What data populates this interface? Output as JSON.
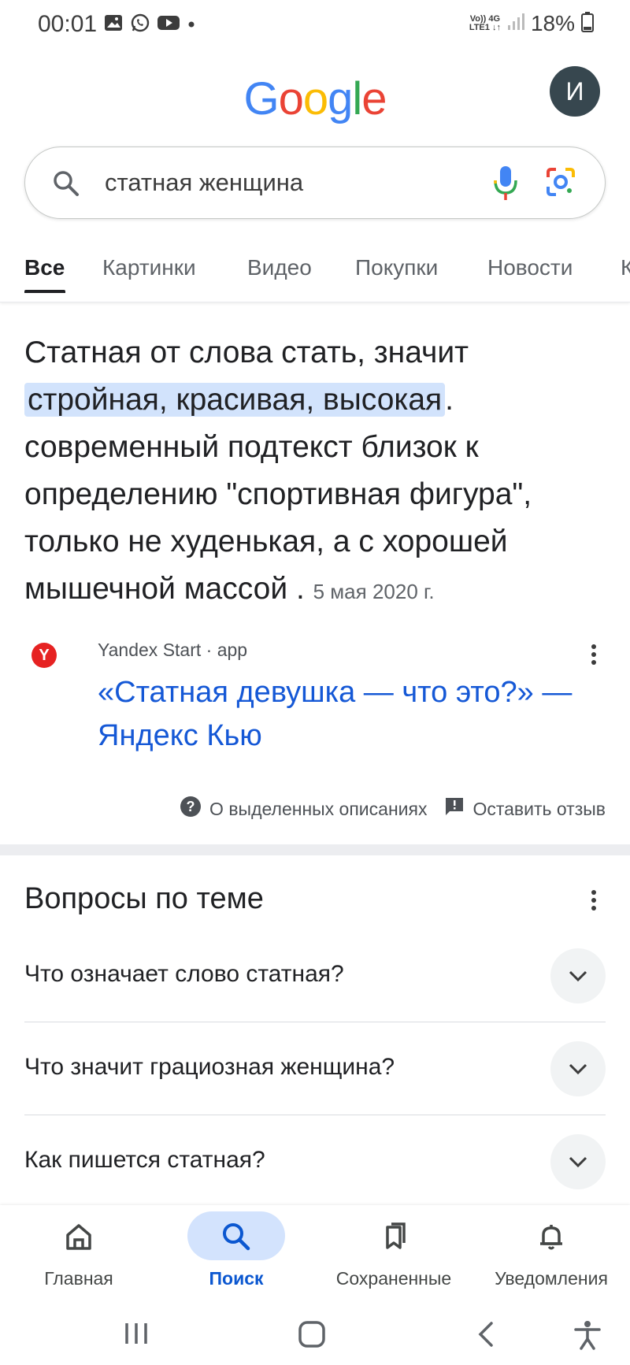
{
  "status_bar": {
    "time": "00:01",
    "net_top": "Vo)) 4G",
    "net_bottom": "LTE1 ↓↑",
    "battery": "18%"
  },
  "header": {
    "logo": "Google",
    "avatar_letter": "И"
  },
  "search": {
    "query": "статная женщина"
  },
  "tabs": [
    {
      "label": "Все",
      "active": true
    },
    {
      "label": "Картинки"
    },
    {
      "label": "Видео"
    },
    {
      "label": "Покупки"
    },
    {
      "label": "Новости"
    },
    {
      "label": "К"
    }
  ],
  "snippet": {
    "text_before": "Статная от слова стать, значит ",
    "highlight": "стройная, красивая, высокая",
    "text_after": ". современный подтекст близок к определению \"спортивная фигура\", только не худенькая, а с хорошей мышечной массой . ",
    "date": "5 мая 2020 г.",
    "source_name": "Yandex Start · app",
    "source_favicon": "Y",
    "source_title": "«Статная девушка — что это?» — Яндекс Кью"
  },
  "feedback": {
    "about": "О выделенных описаниях",
    "leave": "Оставить отзыв"
  },
  "related": {
    "title": "Вопросы по теме",
    "questions": [
      "Что означает слово статная?",
      "Что значит грациозная женщина?",
      "Как пишется статная?"
    ]
  },
  "bottom_nav": [
    {
      "label": "Главная",
      "icon": "home-icon"
    },
    {
      "label": "Поиск",
      "icon": "search-icon",
      "active": true
    },
    {
      "label": "Сохраненные",
      "icon": "saved-icon"
    },
    {
      "label": "Уведомления",
      "icon": "bell-icon"
    }
  ],
  "colors": {
    "link": "#1558d6",
    "highlight": "#d2e3fc",
    "active_nav": "#0b57d0",
    "avatar": "#37474f"
  }
}
